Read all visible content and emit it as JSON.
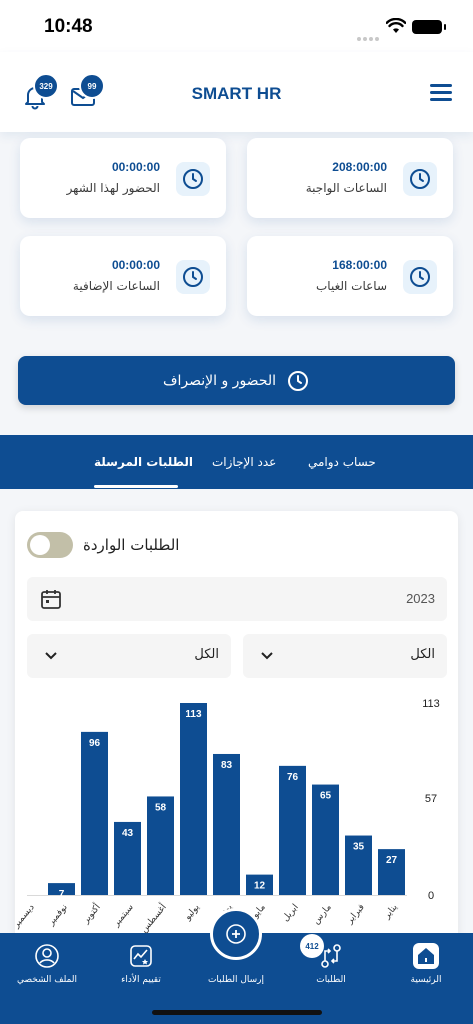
{
  "status_bar": {
    "time": "10:48"
  },
  "header": {
    "title": "SMART HR",
    "notifications_count": "329",
    "messages_count": "99"
  },
  "stats": [
    {
      "value": "208:00:00",
      "label": "الساعات الواجبة"
    },
    {
      "value": "00:00:00",
      "label": "الحضور لهذا الشهر"
    },
    {
      "value": "168:00:00",
      "label": "ساعات الغياب"
    },
    {
      "value": "00:00:00",
      "label": "الساعات الإضافية"
    }
  ],
  "attendance_button": {
    "label": "الحضور و الإنصراف"
  },
  "tabs": [
    {
      "label": "حساب دوامي",
      "active": false
    },
    {
      "label": "عدد الإجازات",
      "active": false
    },
    {
      "label": "الطلبات المرسلة",
      "active": true
    }
  ],
  "panel": {
    "incoming_toggle_label": "الطلبات الواردة",
    "incoming_toggle_on": false,
    "year": "2023",
    "filter_right": "الكل",
    "filter_left": "الكل"
  },
  "chart_data": {
    "type": "bar",
    "categories": [
      "يناير",
      "فبراير",
      "مارس",
      "ابريل",
      "مايو",
      "يونيو",
      "يوليو",
      "أغسطس",
      "سبتمبر",
      "أكتوبر",
      "نوفمبر",
      "ديسمبر"
    ],
    "values": [
      27,
      35,
      65,
      76,
      12,
      83,
      113,
      58,
      43,
      96,
      7,
      0
    ],
    "y_ticks": [
      "0",
      "57",
      "113"
    ],
    "ylim": [
      0,
      113
    ],
    "bar_color": "#0e4d92",
    "orientation": "rtl"
  },
  "bottom_nav": {
    "items": [
      {
        "label": "الرئيسية"
      },
      {
        "label": "الطلبات"
      },
      {
        "label": "إرسال الطلبات"
      },
      {
        "label": "تقييم الأداء"
      },
      {
        "label": "الملف الشخصي"
      }
    ],
    "requests_badge": "412"
  },
  "colors": {
    "primary": "#0e4d92",
    "icon_bg": "#e7f2fb"
  }
}
